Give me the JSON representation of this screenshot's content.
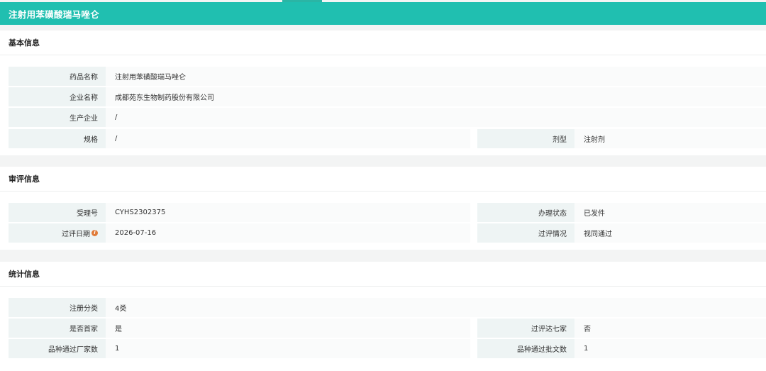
{
  "app": {
    "title": "注射用苯磺酸瑞马唑仑"
  },
  "basic": {
    "heading": "基本信息",
    "rows": [
      {
        "label": "药品名称",
        "value": "注射用苯磺酸瑞马唑仑"
      },
      {
        "label": "企业名称",
        "value": "成都苑东生物制药股份有限公司"
      },
      {
        "label": "生产企业",
        "value": "/"
      },
      {
        "label": "规格",
        "value": "/"
      }
    ],
    "right": [
      {
        "label": "剂型",
        "value": "注射剂"
      }
    ]
  },
  "review": {
    "heading": "审评信息",
    "left": [
      {
        "label": "受理号",
        "value": "CYHS2302375"
      },
      {
        "label": "过评日期",
        "value": "2026-07-16"
      }
    ],
    "right": [
      {
        "label": "办理状态",
        "value": "已发件"
      },
      {
        "label": "过评情况",
        "value": "视同通过"
      }
    ]
  },
  "stats": {
    "heading": "统计信息",
    "left": [
      {
        "label": "注册分类",
        "value": "4类"
      },
      {
        "label": "是否首家",
        "value": "是"
      },
      {
        "label": "品种通过厂家数",
        "value": "1"
      }
    ],
    "right": [
      {
        "label": "过评达七家",
        "value": "否"
      },
      {
        "label": "品种通过批文数",
        "value": "1"
      }
    ]
  },
  "colors": {
    "header": "#20bfb0",
    "label_bg": "#eef4f4",
    "info_icon": "#e07b39"
  },
  "icons": {
    "info": "i"
  }
}
